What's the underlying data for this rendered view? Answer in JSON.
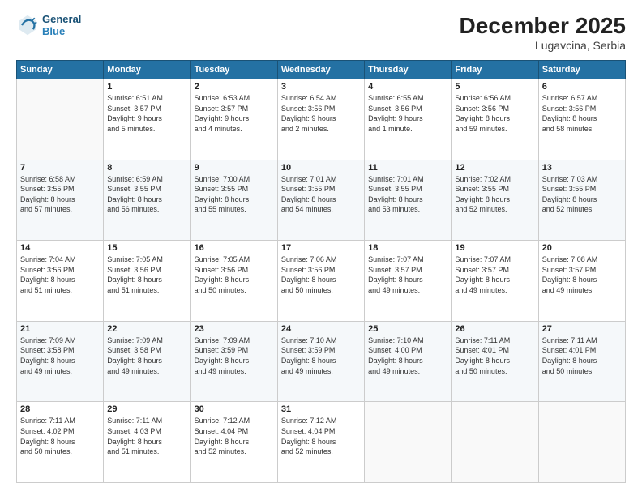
{
  "header": {
    "logo": {
      "line1": "General",
      "line2": "Blue"
    },
    "title": "December 2025",
    "subtitle": "Lugavcina, Serbia"
  },
  "weekdays": [
    "Sunday",
    "Monday",
    "Tuesday",
    "Wednesday",
    "Thursday",
    "Friday",
    "Saturday"
  ],
  "weeks": [
    [
      {
        "day": "",
        "info": ""
      },
      {
        "day": "1",
        "info": "Sunrise: 6:51 AM\nSunset: 3:57 PM\nDaylight: 9 hours\nand 5 minutes."
      },
      {
        "day": "2",
        "info": "Sunrise: 6:53 AM\nSunset: 3:57 PM\nDaylight: 9 hours\nand 4 minutes."
      },
      {
        "day": "3",
        "info": "Sunrise: 6:54 AM\nSunset: 3:56 PM\nDaylight: 9 hours\nand 2 minutes."
      },
      {
        "day": "4",
        "info": "Sunrise: 6:55 AM\nSunset: 3:56 PM\nDaylight: 9 hours\nand 1 minute."
      },
      {
        "day": "5",
        "info": "Sunrise: 6:56 AM\nSunset: 3:56 PM\nDaylight: 8 hours\nand 59 minutes."
      },
      {
        "day": "6",
        "info": "Sunrise: 6:57 AM\nSunset: 3:56 PM\nDaylight: 8 hours\nand 58 minutes."
      }
    ],
    [
      {
        "day": "7",
        "info": "Sunrise: 6:58 AM\nSunset: 3:55 PM\nDaylight: 8 hours\nand 57 minutes."
      },
      {
        "day": "8",
        "info": "Sunrise: 6:59 AM\nSunset: 3:55 PM\nDaylight: 8 hours\nand 56 minutes."
      },
      {
        "day": "9",
        "info": "Sunrise: 7:00 AM\nSunset: 3:55 PM\nDaylight: 8 hours\nand 55 minutes."
      },
      {
        "day": "10",
        "info": "Sunrise: 7:01 AM\nSunset: 3:55 PM\nDaylight: 8 hours\nand 54 minutes."
      },
      {
        "day": "11",
        "info": "Sunrise: 7:01 AM\nSunset: 3:55 PM\nDaylight: 8 hours\nand 53 minutes."
      },
      {
        "day": "12",
        "info": "Sunrise: 7:02 AM\nSunset: 3:55 PM\nDaylight: 8 hours\nand 52 minutes."
      },
      {
        "day": "13",
        "info": "Sunrise: 7:03 AM\nSunset: 3:55 PM\nDaylight: 8 hours\nand 52 minutes."
      }
    ],
    [
      {
        "day": "14",
        "info": "Sunrise: 7:04 AM\nSunset: 3:56 PM\nDaylight: 8 hours\nand 51 minutes."
      },
      {
        "day": "15",
        "info": "Sunrise: 7:05 AM\nSunset: 3:56 PM\nDaylight: 8 hours\nand 51 minutes."
      },
      {
        "day": "16",
        "info": "Sunrise: 7:05 AM\nSunset: 3:56 PM\nDaylight: 8 hours\nand 50 minutes."
      },
      {
        "day": "17",
        "info": "Sunrise: 7:06 AM\nSunset: 3:56 PM\nDaylight: 8 hours\nand 50 minutes."
      },
      {
        "day": "18",
        "info": "Sunrise: 7:07 AM\nSunset: 3:57 PM\nDaylight: 8 hours\nand 49 minutes."
      },
      {
        "day": "19",
        "info": "Sunrise: 7:07 AM\nSunset: 3:57 PM\nDaylight: 8 hours\nand 49 minutes."
      },
      {
        "day": "20",
        "info": "Sunrise: 7:08 AM\nSunset: 3:57 PM\nDaylight: 8 hours\nand 49 minutes."
      }
    ],
    [
      {
        "day": "21",
        "info": "Sunrise: 7:09 AM\nSunset: 3:58 PM\nDaylight: 8 hours\nand 49 minutes."
      },
      {
        "day": "22",
        "info": "Sunrise: 7:09 AM\nSunset: 3:58 PM\nDaylight: 8 hours\nand 49 minutes."
      },
      {
        "day": "23",
        "info": "Sunrise: 7:09 AM\nSunset: 3:59 PM\nDaylight: 8 hours\nand 49 minutes."
      },
      {
        "day": "24",
        "info": "Sunrise: 7:10 AM\nSunset: 3:59 PM\nDaylight: 8 hours\nand 49 minutes."
      },
      {
        "day": "25",
        "info": "Sunrise: 7:10 AM\nSunset: 4:00 PM\nDaylight: 8 hours\nand 49 minutes."
      },
      {
        "day": "26",
        "info": "Sunrise: 7:11 AM\nSunset: 4:01 PM\nDaylight: 8 hours\nand 50 minutes."
      },
      {
        "day": "27",
        "info": "Sunrise: 7:11 AM\nSunset: 4:01 PM\nDaylight: 8 hours\nand 50 minutes."
      }
    ],
    [
      {
        "day": "28",
        "info": "Sunrise: 7:11 AM\nSunset: 4:02 PM\nDaylight: 8 hours\nand 50 minutes."
      },
      {
        "day": "29",
        "info": "Sunrise: 7:11 AM\nSunset: 4:03 PM\nDaylight: 8 hours\nand 51 minutes."
      },
      {
        "day": "30",
        "info": "Sunrise: 7:12 AM\nSunset: 4:04 PM\nDaylight: 8 hours\nand 52 minutes."
      },
      {
        "day": "31",
        "info": "Sunrise: 7:12 AM\nSunset: 4:04 PM\nDaylight: 8 hours\nand 52 minutes."
      },
      {
        "day": "",
        "info": ""
      },
      {
        "day": "",
        "info": ""
      },
      {
        "day": "",
        "info": ""
      }
    ]
  ]
}
